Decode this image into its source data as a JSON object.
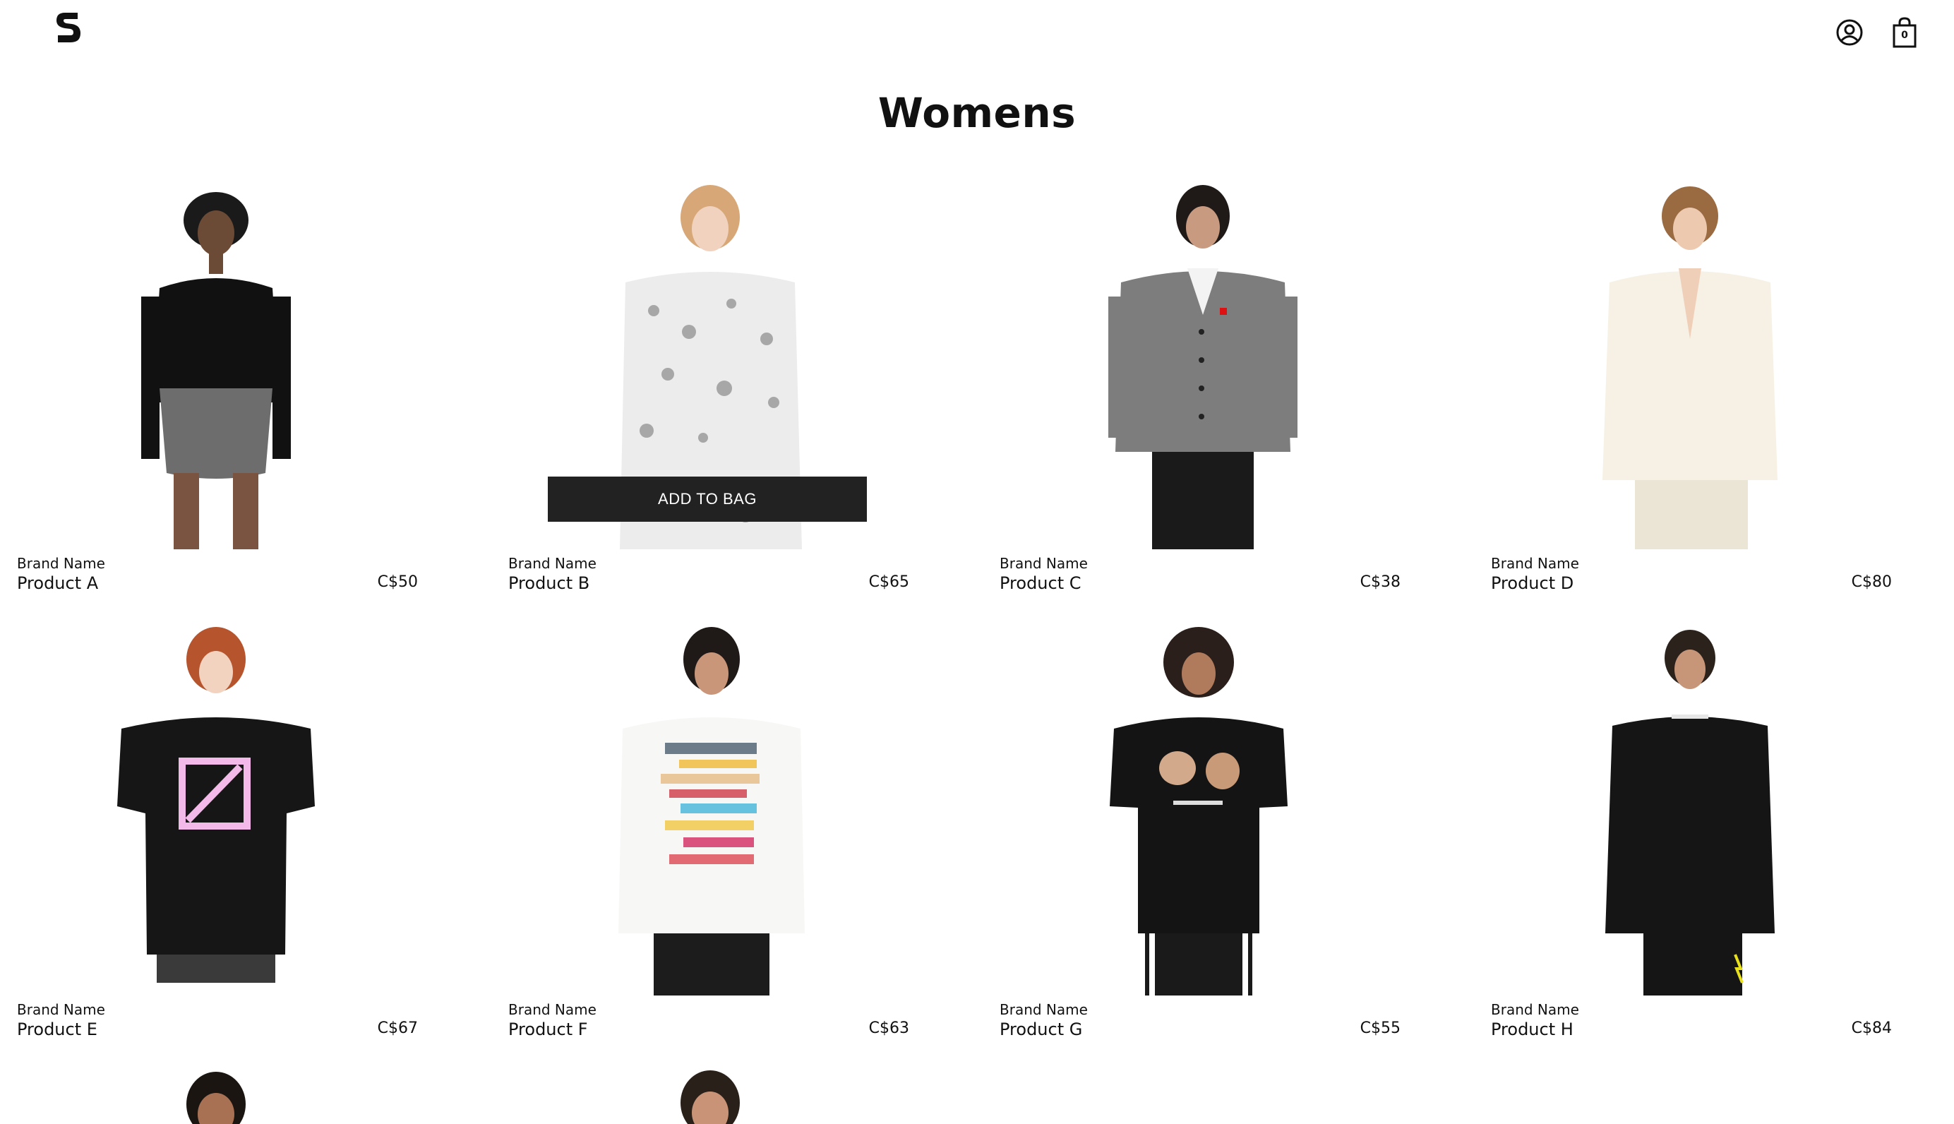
{
  "header": {
    "logo_text": "S",
    "bag_count": "0",
    "icons": {
      "account": "user-circle-icon",
      "bag": "shopping-bag-icon"
    }
  },
  "page": {
    "title": "Womens"
  },
  "add_to_bag_label": "ADD TO BAG",
  "products": [
    {
      "brand": "Brand Name",
      "name": "Product A",
      "price": "C$50",
      "garment": "black-offshoulder-top"
    },
    {
      "brand": "Brand Name",
      "name": "Product B",
      "price": "C$65",
      "garment": "white-printed-shirt"
    },
    {
      "brand": "Brand Name",
      "name": "Product C",
      "price": "C$38",
      "garment": "grey-cardigan"
    },
    {
      "brand": "Brand Name",
      "name": "Product D",
      "price": "C$80",
      "garment": "cream-blazer"
    },
    {
      "brand": "Brand Name",
      "name": "Product E",
      "price": "C$67",
      "garment": "black-graphic-tee"
    },
    {
      "brand": "Brand Name",
      "name": "Product F",
      "price": "C$63",
      "garment": "white-logo-sweatshirt"
    },
    {
      "brand": "Brand Name",
      "name": "Product G",
      "price": "C$55",
      "garment": "black-bear-tee"
    },
    {
      "brand": "Brand Name",
      "name": "Product H",
      "price": "C$84",
      "garment": "black-longsleeve"
    },
    {
      "garment": "partial-model"
    },
    {
      "garment": "partial-model"
    }
  ],
  "colors": {
    "button_bg": "#222222",
    "text": "#111111",
    "background": "#ffffff"
  }
}
